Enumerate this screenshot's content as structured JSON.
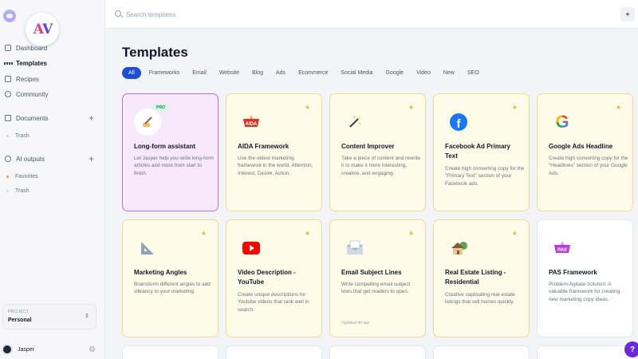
{
  "sidebar": {
    "nav": [
      {
        "label": "Dashboard"
      },
      {
        "label": "Templates"
      },
      {
        "label": "Recipes"
      },
      {
        "label": "Community"
      }
    ],
    "documents": {
      "label": "Documents",
      "plus": "+",
      "sub": [
        {
          "label": "Trash"
        }
      ]
    },
    "ai_outputs": {
      "label": "AI outputs",
      "plus": "+",
      "sub": [
        {
          "label": "Favorites"
        },
        {
          "label": "Trash"
        }
      ]
    },
    "project": {
      "label": "PROJECT",
      "value": "Personal",
      "chevron": "⌃⌄"
    },
    "user": {
      "name": "Jasper"
    }
  },
  "badge": {
    "left": "A",
    "right": "V"
  },
  "search": {
    "placeholder": "Search templates"
  },
  "main": {
    "title": "Templates",
    "filters": [
      "All",
      "Frameworks",
      "Email",
      "Website",
      "Blog",
      "Ads",
      "Ecommerce",
      "Social Media",
      "Google",
      "Video",
      "New",
      "SEO"
    ],
    "cards": [
      {
        "title": "Long-form assistant",
        "desc": "Let Jasper help you write long-form articles and more from start to finish.",
        "badge": "PRO",
        "icon": "pen-hand-icon"
      },
      {
        "title": "AIDA Framework",
        "desc": "Use the oldest marketing framework in the world. Attention, Interest, Desire, Action.",
        "icon_text": "AIDA",
        "icon": "aida-icon"
      },
      {
        "title": "Content Improver",
        "desc": "Take a piece of content and rewrite it to make it more interesting, creative, and engaging.",
        "icon": "magic-wand-icon"
      },
      {
        "title": "Facebook Ad Primary Text",
        "desc": "Create high converting copy for the \"Primary Text\" section of your Facebook ads.",
        "icon": "facebook-icon",
        "icon_text": "f"
      },
      {
        "title": "Google Ads Headline",
        "desc": "Create high converting copy for the \"Headlines\" section of your Google Ads.",
        "icon": "google-icon",
        "icon_text": "G"
      },
      {
        "title": "Marketing Angles",
        "desc": "Brainstorm different angles to add vibrancy to your marketing.",
        "icon": "triangle-ruler-icon"
      },
      {
        "title": "Video Description - YouTube",
        "desc": "Create unique descriptions for Youtube videos that rank well in search.",
        "icon": "youtube-icon"
      },
      {
        "title": "Email Subject Lines",
        "desc": "Write compelling email subject lines that get readers to open.",
        "updated": "Updated 4d ago",
        "icon": "email-icon"
      },
      {
        "title": "Real Estate Listing - Residential",
        "desc": "Creative captivating real estate listings that sell homes quickly.",
        "icon": "house-icon"
      },
      {
        "title": "PAS Framework",
        "desc": "Problem-Agitate-Solution. A valuable framework for creating new marketing copy ideas.",
        "icon": "pas-icon",
        "icon_text": "PAS"
      }
    ]
  },
  "help": {
    "label": "?"
  },
  "colors": {
    "accent": "#1d4ed8",
    "card_bg": "#fffbe9",
    "card_border": "#f3d98e",
    "selected_bg": "#f7e8fb",
    "selected_border": "#c36fd8"
  }
}
